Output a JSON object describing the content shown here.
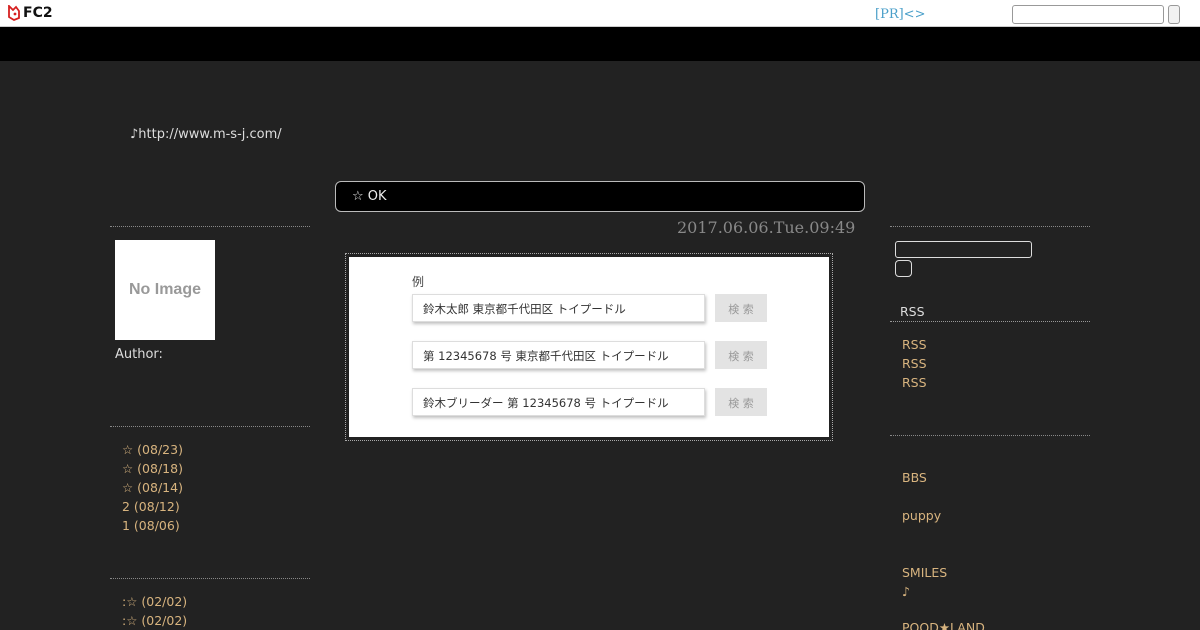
{
  "fc2bar": {
    "logo_text": "FC2",
    "pr_link": "[PR]<>",
    "search_value": ""
  },
  "header": {
    "blog_url": "♪http://www.m-s-j.com/"
  },
  "profile": {
    "image_text": "No Image",
    "author_label": "Author:"
  },
  "recent_entries": [
    "☆ (08/23)",
    "☆ (08/18)",
    "☆ (08/14)",
    "2 (08/12)",
    "1 (08/06)"
  ],
  "recent_comments": [
    ":☆ (02/02)",
    ":☆ (02/02)"
  ],
  "entry": {
    "title": "☆ OK",
    "date": "2017.06.06.Tue.09:49",
    "image": {
      "label": "例",
      "rows": [
        {
          "text": "鈴木太郎 東京都千代田区 トイプードル",
          "button": "検 索"
        },
        {
          "text": "第 12345678 号 東京都千代田区 トイプードル",
          "button": "検 索"
        },
        {
          "text": "鈴木ブリーダー 第 12345678 号 トイプードル",
          "button": "検 索"
        }
      ]
    }
  },
  "right_sidebar": {
    "search_value": "",
    "rss_heading": "RSS",
    "rss_links": [
      "RSS",
      "RSS",
      "RSS"
    ],
    "links": {
      "bbs": "BBS",
      "puppy": "puppy",
      "smiles": "SMILES",
      "note": "♪",
      "pood": "POOD★LAND"
    }
  },
  "colors": {
    "background": "#222222",
    "link": "#d8b47f",
    "banner": "#000000",
    "pr_link": "#4a9fc9"
  }
}
